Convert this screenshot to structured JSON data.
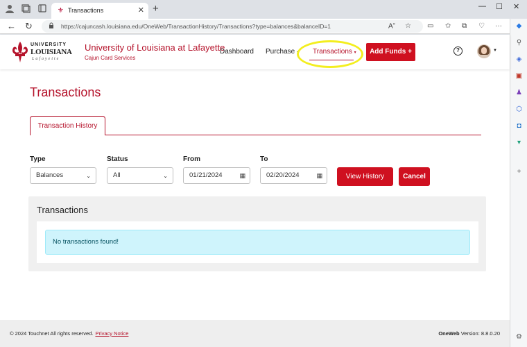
{
  "browser": {
    "tab_title": "Transactions",
    "url": "https://cajuncash.louisiana.edu/OneWeb/TransactionHistory/Transactions?type=balances&balanceID=1",
    "url_host": "cajuncash.louisiana.edu",
    "new_tab_glyph": "+",
    "close_tab_glyph": "✕"
  },
  "header": {
    "logo_university": "UNIVERSITY",
    "logo_louisiana": "LOUISIANA",
    "logo_lafayette": "Lafayette",
    "title": "University of Louisiana at Lafayette",
    "subtitle": "Cajun Card Services",
    "nav": {
      "dashboard": "Dashboard",
      "purchase": "Purchase",
      "transactions": "Transactions"
    },
    "add_funds_label": "Add Funds +",
    "help_glyph": "?"
  },
  "main": {
    "page_title": "Transactions",
    "tab_label": "Transaction History",
    "filters": {
      "type_label": "Type",
      "type_value": "Balances",
      "status_label": "Status",
      "status_value": "All",
      "from_label": "From",
      "from_value": "01/21/2024",
      "to_label": "To",
      "to_value": "02/20/2024"
    },
    "view_history_label": "View History",
    "cancel_label": "Cancel",
    "panel_title": "Transactions",
    "empty_message": "No transactions found!"
  },
  "footer": {
    "copyright": "© 2024 Touchnet All rights reserved.",
    "privacy_label": "Privacy Notice",
    "product": "OneWeb",
    "version": "Version: 8.8.0.20"
  },
  "colors": {
    "brand_red": "#b5132b",
    "button_red": "#cf1020",
    "alert_bg": "#cff4fc",
    "highlight": "#f3ee1f"
  }
}
